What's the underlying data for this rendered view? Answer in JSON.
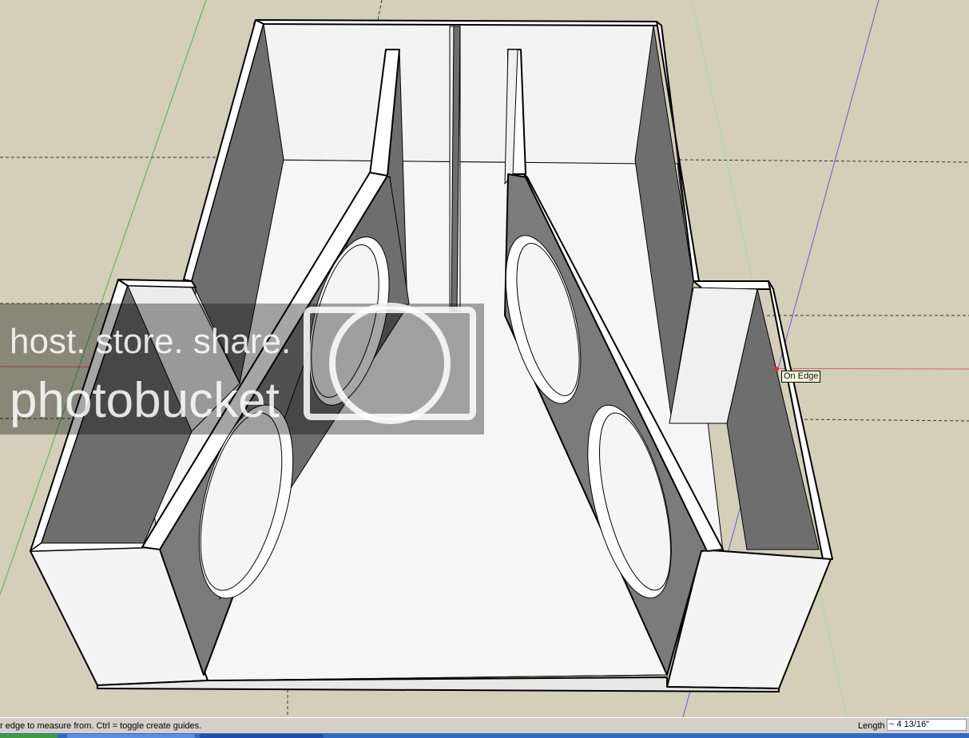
{
  "tooltip": {
    "text": "On Edge"
  },
  "watermark": {
    "line1": "host. store. share.",
    "line2": "photobucket"
  },
  "status": {
    "message": "r edge to measure from.  Ctrl = toggle create guides.",
    "measurement_label": "Length",
    "measurement_value": "~ 4 13/16\""
  },
  "colors": {
    "background": "#d3cfb8",
    "face_light": "#f7f7f7",
    "face_shaded": "#6e6e6e",
    "axis_red": "#e06060",
    "axis_green": "#46b846",
    "axis_blue": "#5c5cdc"
  }
}
